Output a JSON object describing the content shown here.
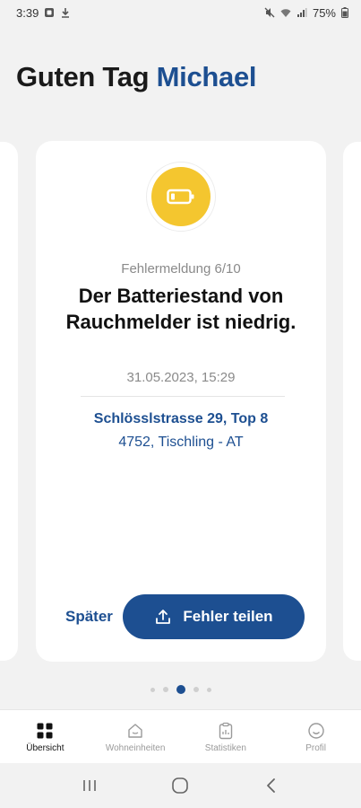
{
  "status_bar": {
    "time": "3:39",
    "battery": "75%"
  },
  "greeting": {
    "prefix": "Guten Tag",
    "name": "Michael"
  },
  "alert": {
    "icon": "battery-low-icon",
    "counter": "Fehlermeldung 6/10",
    "title": "Der Batteriestand von Rauchmelder ist niedrig.",
    "datetime": "31.05.2023, 15:29",
    "address_line1": "Schlösslstrasse 29, Top 8",
    "address_line2": "4752, Tischling - AT",
    "later_label": "Später",
    "share_label": "Fehler teilen"
  },
  "pager": {
    "count": 5,
    "active_index": 2
  },
  "bottom_nav": {
    "items": [
      {
        "label": "Übersicht",
        "icon": "grid-icon",
        "active": true
      },
      {
        "label": "Wohneinheiten",
        "icon": "home-icon",
        "active": false
      },
      {
        "label": "Statistiken",
        "icon": "clipboard-icon",
        "active": false
      },
      {
        "label": "Profil",
        "icon": "smiley-icon",
        "active": false
      }
    ]
  },
  "colors": {
    "primary": "#1d4f91",
    "warning": "#f4c62f",
    "background": "#f2f2f2"
  }
}
